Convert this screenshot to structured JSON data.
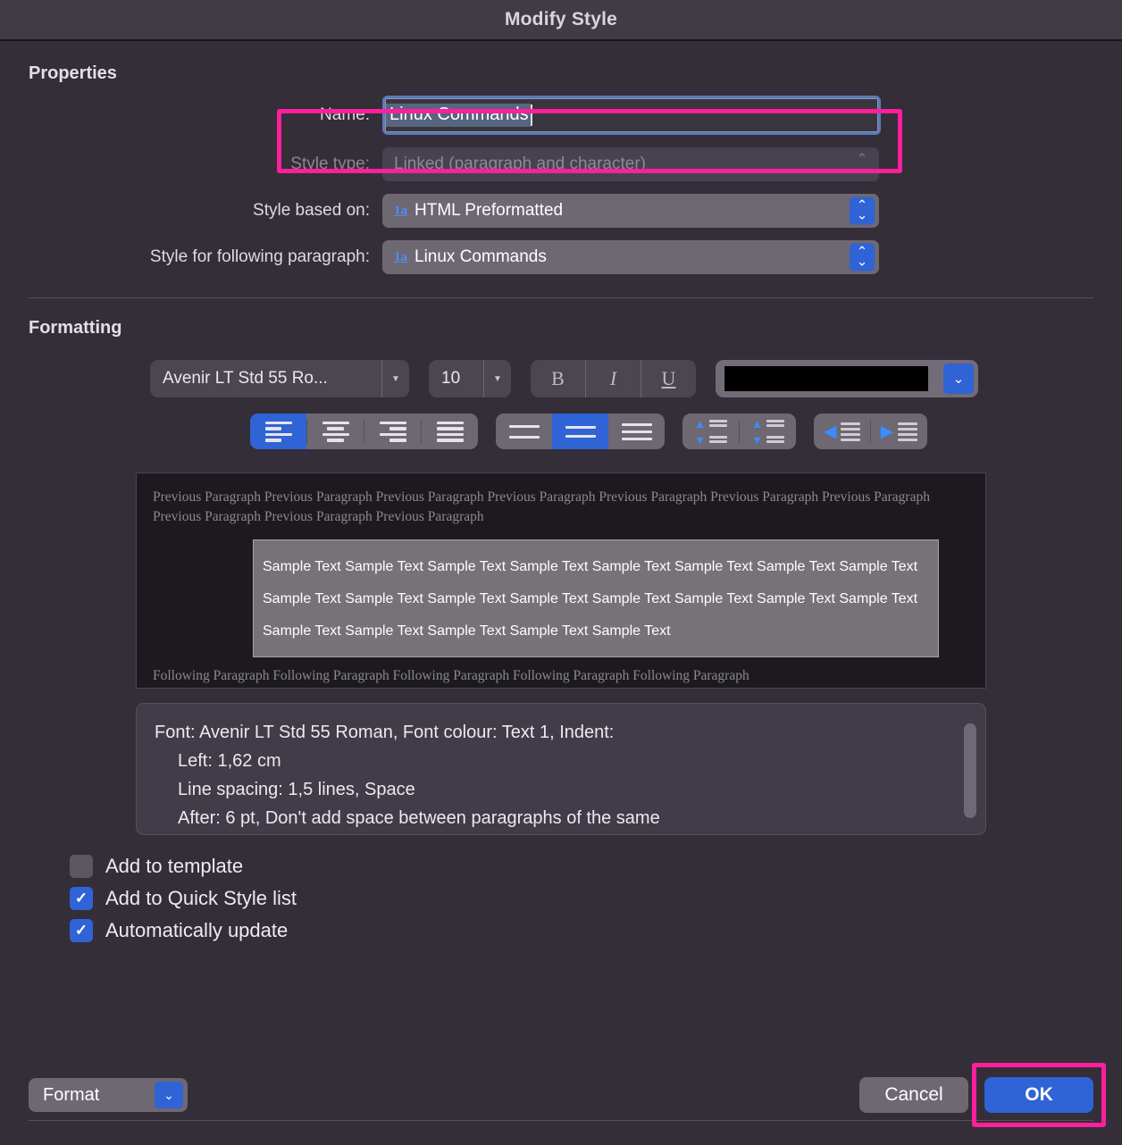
{
  "window": {
    "title": "Modify Style"
  },
  "properties": {
    "heading": "Properties",
    "name": {
      "label": "Name:",
      "value": "Linux Commands"
    },
    "style_type": {
      "label": "Style type:",
      "value": "Linked (paragraph and character)"
    },
    "style_based_on": {
      "label": "Style based on:",
      "value": "HTML Preformatted",
      "icon": "1a"
    },
    "style_following": {
      "label": "Style for following paragraph:",
      "value": "Linux Commands",
      "icon": "1a"
    }
  },
  "formatting": {
    "heading": "Formatting",
    "font_family": "Avenir LT Std 55 Ro...",
    "font_size": "10",
    "bold": "B",
    "italic": "I",
    "underline": "U",
    "font_color": "#000000",
    "alignment": "left",
    "line_spacing": "1.5",
    "accent_color": "#2f63d6"
  },
  "preview": {
    "previous_paragraph": "Previous Paragraph Previous Paragraph Previous Paragraph Previous Paragraph Previous Paragraph Previous Paragraph Previous Paragraph Previous Paragraph Previous Paragraph Previous Paragraph",
    "sample_text": "Sample Text Sample Text Sample Text Sample Text Sample Text Sample Text Sample Text Sample Text Sample Text Sample Text Sample Text Sample Text Sample Text Sample Text Sample Text Sample Text Sample Text Sample Text Sample Text Sample Text Sample Text",
    "following_paragraph": "Following Paragraph Following Paragraph Following Paragraph Following Paragraph Following Paragraph"
  },
  "description": {
    "line1": "Font: Avenir LT Std 55 Roman, Font colour: Text 1, Indent:",
    "line2": "Left:  1,62 cm",
    "line3": "Line spacing:  1,5 lines, Space",
    "line4": "After:  6 pt, Don't add space between paragraphs of the same"
  },
  "options": [
    {
      "label": "Add to template",
      "checked": false
    },
    {
      "label": "Add to Quick Style list",
      "checked": true
    },
    {
      "label": "Automatically update",
      "checked": true
    }
  ],
  "footer": {
    "format_label": "Format",
    "cancel_label": "Cancel",
    "ok_label": "OK"
  },
  "glyphs": {
    "check": "✓",
    "chevron_down": "⌄",
    "triangle_down": "▼",
    "stepper_up": "⌃",
    "stepper_down": "⌄",
    "arrow_left": "◀",
    "arrow_right": "▶",
    "arrow_up": "▲",
    "arrow_down": "▼"
  }
}
